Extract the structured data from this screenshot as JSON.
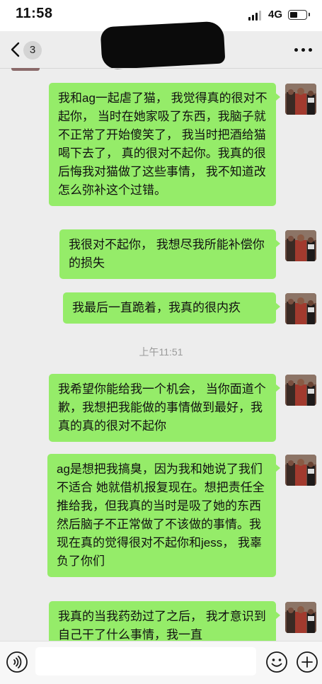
{
  "status_bar": {
    "time": "11:58",
    "network": "4G"
  },
  "nav": {
    "unread_count": "3",
    "icons": [
      "back-icon",
      "more-icon"
    ]
  },
  "chat": {
    "timestamp": "上午11:51",
    "messages": [
      {
        "sender": "self",
        "text": "我和ag一起虐了猫， 我觉得真的很对不起你， 当时在她家吸了东西，我脑子就不正常了开始傻笑了， 我当时把酒给猫喝下去了， 真的很对不起你。我真的很后悔我对猫做了这些事情， 我不知道改怎么弥补这个过错。"
      },
      {
        "sender": "self",
        "text": "我很对不起你， 我想尽我所能补偿你的损失"
      },
      {
        "sender": "self",
        "text": "我最后一直跪着，我真的很内疚"
      },
      {
        "sender": "self",
        "text": "我希望你能给我一个机会， 当你面道个歉，我想把我能做的事情做到最好，我真的真的很对不起你"
      },
      {
        "sender": "self",
        "text": "ag是想把我搞臭，因为我和她说了我们不适合 她就借机报复现在。想把责任全推给我，但我真的当时是吸了她的东西 然后脑子不正常做了不该做的事情。我现在真的觉得很对不起你和jess， 我辜负了你们"
      },
      {
        "sender": "self",
        "text": "我真的当我药劲过了之后， 我才意识到自己干了什么事情，我一直"
      }
    ]
  },
  "input_bar": {
    "icons": [
      "voice-icon",
      "emoji-icon",
      "plus-icon"
    ]
  },
  "colors": {
    "bubble_self": "#95ec69",
    "chat_background": "#ededed",
    "timestamp_text": "#9a9a9a"
  }
}
